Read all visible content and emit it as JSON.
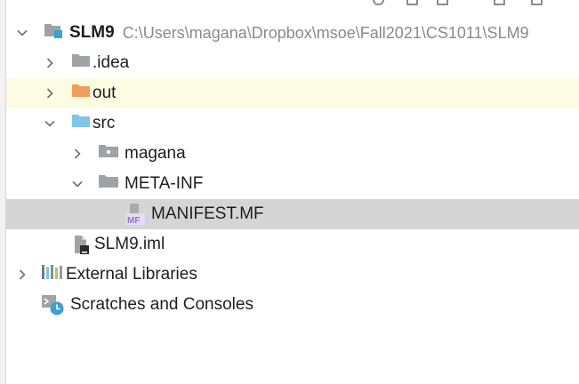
{
  "colors": {
    "highlight_row": "#fdfbe2",
    "selected_row": "#d5d5d5",
    "folder_gray": "#9ea3a8",
    "folder_orange": "#f29c59",
    "folder_blue": "#7fc6e8",
    "module_accent": "#3c9fd6",
    "manifest_purple": "#9a6ed0",
    "text": "#1e1e1e",
    "path_text": "#8a8a8a"
  },
  "tree": {
    "project": {
      "name": "SLM9",
      "path": "C:\\Users\\magana\\Dropbox\\msoe\\Fall2021\\CS1011\\SLM9",
      "icon": "module-folder-icon"
    },
    "idea": {
      "label": ".idea",
      "icon": "folder-icon"
    },
    "out": {
      "label": "out",
      "icon": "excluded-folder-icon"
    },
    "src": {
      "label": "src",
      "icon": "source-folder-icon"
    },
    "magana": {
      "label": "magana",
      "icon": "package-icon"
    },
    "meta_inf": {
      "label": "META-INF",
      "icon": "folder-icon"
    },
    "manifest": {
      "label": "MANIFEST.MF",
      "icon": "manifest-file-icon",
      "icon_text": "MF"
    },
    "iml": {
      "label": "SLM9.iml",
      "icon": "iml-file-icon"
    },
    "external_libraries": {
      "label": "External Libraries",
      "icon": "libraries-icon"
    },
    "scratches": {
      "label": "Scratches and Consoles",
      "icon": "scratches-icon"
    }
  }
}
